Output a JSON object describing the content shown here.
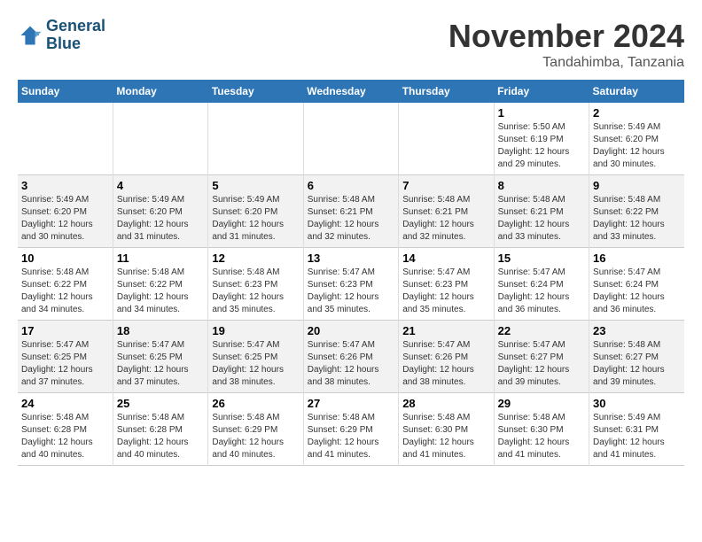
{
  "header": {
    "logo_line1": "General",
    "logo_line2": "Blue",
    "month_title": "November 2024",
    "location": "Tandahimba, Tanzania"
  },
  "days_of_week": [
    "Sunday",
    "Monday",
    "Tuesday",
    "Wednesday",
    "Thursday",
    "Friday",
    "Saturday"
  ],
  "weeks": [
    {
      "cells": [
        {
          "day": "",
          "empty": true
        },
        {
          "day": "",
          "empty": true
        },
        {
          "day": "",
          "empty": true
        },
        {
          "day": "",
          "empty": true
        },
        {
          "day": "",
          "empty": true
        },
        {
          "day": "1",
          "sunrise": "5:50 AM",
          "sunset": "6:19 PM",
          "daylight": "12 hours and 29 minutes."
        },
        {
          "day": "2",
          "sunrise": "5:49 AM",
          "sunset": "6:20 PM",
          "daylight": "12 hours and 30 minutes."
        }
      ]
    },
    {
      "cells": [
        {
          "day": "3",
          "sunrise": "5:49 AM",
          "sunset": "6:20 PM",
          "daylight": "12 hours and 30 minutes."
        },
        {
          "day": "4",
          "sunrise": "5:49 AM",
          "sunset": "6:20 PM",
          "daylight": "12 hours and 31 minutes."
        },
        {
          "day": "5",
          "sunrise": "5:49 AM",
          "sunset": "6:20 PM",
          "daylight": "12 hours and 31 minutes."
        },
        {
          "day": "6",
          "sunrise": "5:48 AM",
          "sunset": "6:21 PM",
          "daylight": "12 hours and 32 minutes."
        },
        {
          "day": "7",
          "sunrise": "5:48 AM",
          "sunset": "6:21 PM",
          "daylight": "12 hours and 32 minutes."
        },
        {
          "day": "8",
          "sunrise": "5:48 AM",
          "sunset": "6:21 PM",
          "daylight": "12 hours and 33 minutes."
        },
        {
          "day": "9",
          "sunrise": "5:48 AM",
          "sunset": "6:22 PM",
          "daylight": "12 hours and 33 minutes."
        }
      ]
    },
    {
      "cells": [
        {
          "day": "10",
          "sunrise": "5:48 AM",
          "sunset": "6:22 PM",
          "daylight": "12 hours and 34 minutes."
        },
        {
          "day": "11",
          "sunrise": "5:48 AM",
          "sunset": "6:22 PM",
          "daylight": "12 hours and 34 minutes."
        },
        {
          "day": "12",
          "sunrise": "5:48 AM",
          "sunset": "6:23 PM",
          "daylight": "12 hours and 35 minutes."
        },
        {
          "day": "13",
          "sunrise": "5:47 AM",
          "sunset": "6:23 PM",
          "daylight": "12 hours and 35 minutes."
        },
        {
          "day": "14",
          "sunrise": "5:47 AM",
          "sunset": "6:23 PM",
          "daylight": "12 hours and 35 minutes."
        },
        {
          "day": "15",
          "sunrise": "5:47 AM",
          "sunset": "6:24 PM",
          "daylight": "12 hours and 36 minutes."
        },
        {
          "day": "16",
          "sunrise": "5:47 AM",
          "sunset": "6:24 PM",
          "daylight": "12 hours and 36 minutes."
        }
      ]
    },
    {
      "cells": [
        {
          "day": "17",
          "sunrise": "5:47 AM",
          "sunset": "6:25 PM",
          "daylight": "12 hours and 37 minutes."
        },
        {
          "day": "18",
          "sunrise": "5:47 AM",
          "sunset": "6:25 PM",
          "daylight": "12 hours and 37 minutes."
        },
        {
          "day": "19",
          "sunrise": "5:47 AM",
          "sunset": "6:25 PM",
          "daylight": "12 hours and 38 minutes."
        },
        {
          "day": "20",
          "sunrise": "5:47 AM",
          "sunset": "6:26 PM",
          "daylight": "12 hours and 38 minutes."
        },
        {
          "day": "21",
          "sunrise": "5:47 AM",
          "sunset": "6:26 PM",
          "daylight": "12 hours and 38 minutes."
        },
        {
          "day": "22",
          "sunrise": "5:47 AM",
          "sunset": "6:27 PM",
          "daylight": "12 hours and 39 minutes."
        },
        {
          "day": "23",
          "sunrise": "5:48 AM",
          "sunset": "6:27 PM",
          "daylight": "12 hours and 39 minutes."
        }
      ]
    },
    {
      "cells": [
        {
          "day": "24",
          "sunrise": "5:48 AM",
          "sunset": "6:28 PM",
          "daylight": "12 hours and 40 minutes."
        },
        {
          "day": "25",
          "sunrise": "5:48 AM",
          "sunset": "6:28 PM",
          "daylight": "12 hours and 40 minutes."
        },
        {
          "day": "26",
          "sunrise": "5:48 AM",
          "sunset": "6:29 PM",
          "daylight": "12 hours and 40 minutes."
        },
        {
          "day": "27",
          "sunrise": "5:48 AM",
          "sunset": "6:29 PM",
          "daylight": "12 hours and 41 minutes."
        },
        {
          "day": "28",
          "sunrise": "5:48 AM",
          "sunset": "6:30 PM",
          "daylight": "12 hours and 41 minutes."
        },
        {
          "day": "29",
          "sunrise": "5:48 AM",
          "sunset": "6:30 PM",
          "daylight": "12 hours and 41 minutes."
        },
        {
          "day": "30",
          "sunrise": "5:49 AM",
          "sunset": "6:31 PM",
          "daylight": "12 hours and 41 minutes."
        }
      ]
    }
  ]
}
